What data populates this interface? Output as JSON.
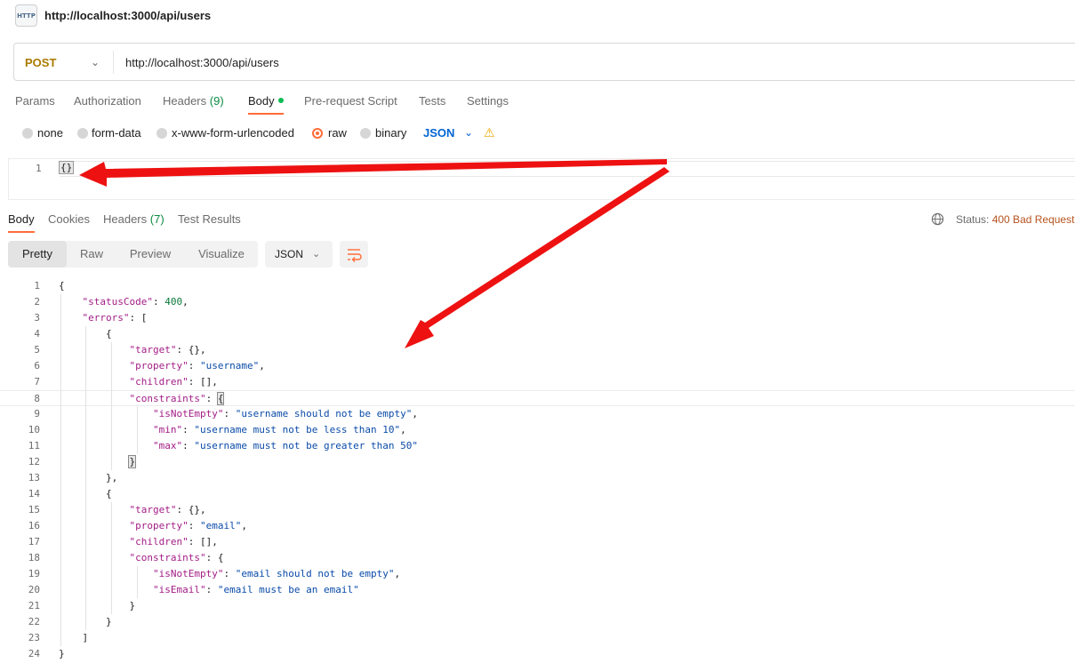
{
  "window": {
    "title": "http://localhost:3000/api/users",
    "icon": "http-icon"
  },
  "request": {
    "method": "POST",
    "url": "http://localhost:3000/api/users",
    "tabs": [
      {
        "label": "Params",
        "count": ""
      },
      {
        "label": "Authorization",
        "count": ""
      },
      {
        "label": "Headers",
        "count": "(9)"
      },
      {
        "label": "Body",
        "count": "",
        "active": true,
        "indicator": "green-dot"
      },
      {
        "label": "Pre-request Script",
        "count": ""
      },
      {
        "label": "Tests",
        "count": ""
      },
      {
        "label": "Settings",
        "count": ""
      }
    ],
    "body_types": [
      {
        "label": "none",
        "selected": false
      },
      {
        "label": "form-data",
        "selected": false
      },
      {
        "label": "x-www-form-urlencoded",
        "selected": false
      },
      {
        "label": "raw",
        "selected": true
      },
      {
        "label": "binary",
        "selected": false
      }
    ],
    "raw_format": "JSON",
    "editor": {
      "line_numbers": [
        "1"
      ],
      "content": "{}"
    }
  },
  "response": {
    "tabs": [
      {
        "label": "Body",
        "count": "",
        "active": true
      },
      {
        "label": "Cookies",
        "count": ""
      },
      {
        "label": "Headers",
        "count": "(7)"
      },
      {
        "label": "Test Results",
        "count": ""
      }
    ],
    "status_label": "Status:",
    "status_value": "400 Bad Request",
    "view_modes": [
      "Pretty",
      "Raw",
      "Preview",
      "Visualize"
    ],
    "active_view": "Pretty",
    "format": "JSON",
    "code_lines": [
      "{",
      "    \"statusCode\": 400,",
      "    \"errors\": [",
      "        {",
      "            \"target\": {},",
      "            \"property\": \"username\",",
      "            \"children\": [],",
      "            \"constraints\": {",
      "                \"isNotEmpty\": \"username should not be empty\",",
      "                \"min\": \"username must not be less than 10\",",
      "                \"max\": \"username must not be greater than 50\"",
      "            }",
      "        },",
      "        {",
      "            \"target\": {},",
      "            \"property\": \"email\",",
      "            \"children\": [],",
      "            \"constraints\": {",
      "                \"isNotEmpty\": \"email should not be empty\",",
      "                \"isEmail\": \"email must be an email\"",
      "            }",
      "        }",
      "    ]",
      "}"
    ]
  },
  "colors": {
    "accent": "#ff6c37",
    "method": "#ab7a00",
    "json_key": "#a21d86",
    "json_string": "#0a4ba8",
    "json_number": "#0b7a3a",
    "status": "#b7531f",
    "annotation_arrow": "#ee1111"
  }
}
